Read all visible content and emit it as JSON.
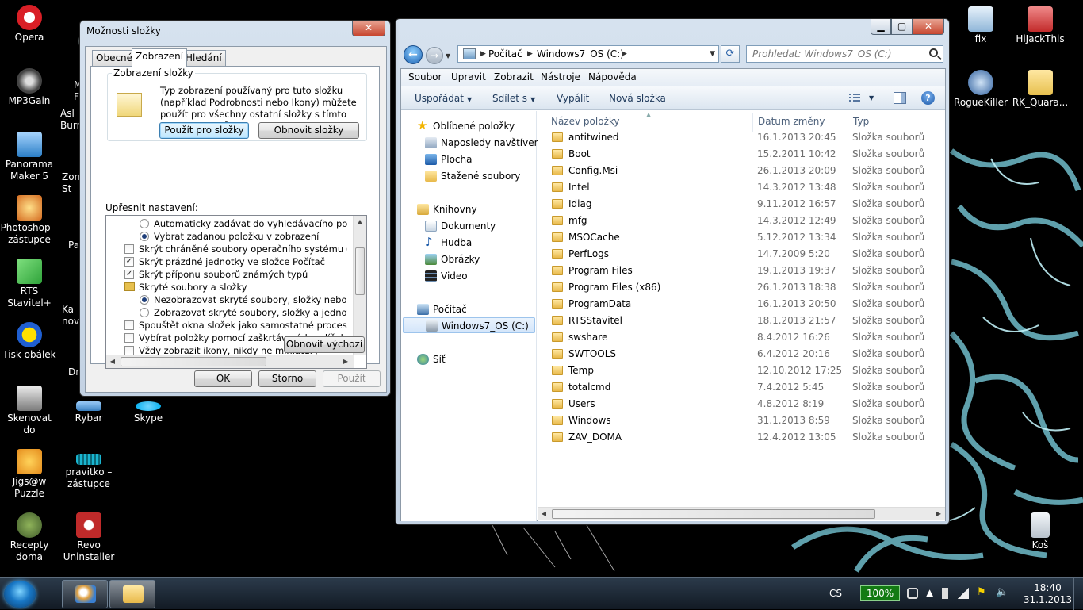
{
  "desktop": {
    "left_icons": [
      {
        "label": "Opera",
        "color": "#d91f26"
      },
      {
        "label": "MP3Gain",
        "color": "#555555"
      },
      {
        "label": "Panorama Maker 5",
        "color": "#2b7ec6"
      },
      {
        "label": "Photoshop – zástupce",
        "color": "#d46a1f"
      },
      {
        "label": "RTS Stavitel+",
        "color": "#2fa33a"
      },
      {
        "label": "Tisk obálek",
        "color": "#1f5fd1"
      },
      {
        "label": "Skenovat do",
        "color": "#7a7a7a"
      },
      {
        "label": "Jigs@w Puzzle",
        "color": "#e48a1b"
      },
      {
        "label": "Recepty doma",
        "color": "#3f5a2a"
      }
    ],
    "col2_partial_labels": [
      "M\nF",
      "Asl\nBurn",
      "Zon\nSt",
      "Pa",
      "Ka\nnov",
      "Dr"
    ],
    "col2_icons": [
      {
        "label": "Rybar",
        "color": "#3a7fbf"
      },
      {
        "label": "pravitko – zástupce",
        "color": "#1ab5d0"
      },
      {
        "label": "Revo Uninstaller",
        "color": "#c02a2a"
      }
    ],
    "col3_icons": [
      {
        "label": "Skype",
        "color": "#00aff0"
      }
    ],
    "right_icons": [
      {
        "label": "fix",
        "color": "#8fb6d8"
      },
      {
        "label": "HiJackThis",
        "color": "#c22a2a"
      },
      {
        "label": "RogueKiller",
        "color": "#2c5d9c"
      },
      {
        "label": "RK_Quara...",
        "color": "#e7c04e"
      },
      {
        "label": "Koš",
        "color": "#b8c2cc"
      }
    ]
  },
  "taskbar": {
    "language": "CS",
    "battery": "100%",
    "time": "18:40",
    "date": "31.1.2013"
  },
  "dialog": {
    "title": "Možnosti složky",
    "close_label": "✕",
    "tabs": [
      "Obecné",
      "Zobrazení",
      "Hledání"
    ],
    "active_tab": "Zobrazení",
    "group_title": "Zobrazení složky",
    "group_text": "Typ zobrazení používaný pro tuto složku (například Podrobnosti nebo Ikony) můžete použít pro všechny ostatní složky s tímto typem souborů.",
    "apply_to_folders": "Použít pro složky",
    "reset_folders": "Obnovit složky",
    "advanced_label": "Upřesnit nastavení:",
    "advanced_items": [
      {
        "kind": "radio",
        "checked": false,
        "indent": 2,
        "text": "Automaticky zadávat do vyhledávacího pole"
      },
      {
        "kind": "radio",
        "checked": true,
        "indent": 2,
        "text": "Vybrat zadanou položku v zobrazení"
      },
      {
        "kind": "check",
        "checked": false,
        "indent": 1,
        "text": "Skrýt chráněné soubory operačního systému (doporučeno)"
      },
      {
        "kind": "check",
        "checked": true,
        "indent": 1,
        "text": "Skrýt prázdné jednotky ve složce Počítač"
      },
      {
        "kind": "check",
        "checked": true,
        "indent": 1,
        "text": "Skrýt příponu souborů známých typů"
      },
      {
        "kind": "folder",
        "checked": false,
        "indent": 1,
        "text": "Skryté soubory a složky"
      },
      {
        "kind": "radio",
        "checked": true,
        "indent": 2,
        "text": "Nezobrazovat skryté soubory, složky nebo jednotky"
      },
      {
        "kind": "radio",
        "checked": false,
        "indent": 2,
        "text": "Zobrazovat skryté soubory, složky a jednotky"
      },
      {
        "kind": "check",
        "checked": false,
        "indent": 1,
        "text": "Spouštět okna složek jako samostatné procesy"
      },
      {
        "kind": "check",
        "checked": false,
        "indent": 1,
        "text": "Vybírat položky pomocí zaškrtávacích políček"
      },
      {
        "kind": "check",
        "checked": false,
        "indent": 1,
        "text": "Vždy zobrazit ikony, nikdy ne miniatury"
      }
    ],
    "restore_defaults": "Obnovit výchozí",
    "ok": "OK",
    "cancel": "Storno",
    "apply": "Použít"
  },
  "explorer": {
    "address": {
      "root": "Počítač",
      "drive": "Windows7_OS (C:)"
    },
    "search_placeholder": "Prohledat: Windows7_OS (C:)",
    "menu": [
      "Soubor",
      "Upravit",
      "Zobrazit",
      "Nástroje",
      "Nápověda"
    ],
    "commands": [
      "Uspořádat",
      "Sdílet s",
      "Vypálit",
      "Nová složka"
    ],
    "help": "?",
    "nav": {
      "favorites": "Oblíbené položky",
      "favorites_items": [
        "Naposledy navštívené",
        "Plocha",
        "Stažené soubory"
      ],
      "libraries": "Knihovny",
      "libraries_items": [
        "Dokumenty",
        "Hudba",
        "Obrázky",
        "Video"
      ],
      "computer": "Počítač",
      "computer_items": [
        "Windows7_OS (C:)"
      ],
      "network": "Síť"
    },
    "columns": [
      "Název položky",
      "Datum změny",
      "Typ"
    ],
    "files": [
      {
        "name": "antitwined",
        "date": "16.1.2013 20:45",
        "type": "Složka souborů"
      },
      {
        "name": "Boot",
        "date": "15.2.2011 10:42",
        "type": "Složka souborů"
      },
      {
        "name": "Config.Msi",
        "date": "26.1.2013 20:09",
        "type": "Složka souborů"
      },
      {
        "name": "Intel",
        "date": "14.3.2012 13:48",
        "type": "Složka souborů"
      },
      {
        "name": "Idiag",
        "date": "9.11.2012 16:57",
        "type": "Složka souborů"
      },
      {
        "name": "mfg",
        "date": "14.3.2012 12:49",
        "type": "Složka souborů"
      },
      {
        "name": "MSOCache",
        "date": "5.12.2012 13:34",
        "type": "Složka souborů"
      },
      {
        "name": "PerfLogs",
        "date": "14.7.2009 5:20",
        "type": "Složka souborů"
      },
      {
        "name": "Program Files",
        "date": "19.1.2013 19:37",
        "type": "Složka souborů"
      },
      {
        "name": "Program Files (x86)",
        "date": "26.1.2013 18:38",
        "type": "Složka souborů"
      },
      {
        "name": "ProgramData",
        "date": "16.1.2013 20:50",
        "type": "Složka souborů"
      },
      {
        "name": "RTSStavitel",
        "date": "18.1.2013 21:57",
        "type": "Složka souborů"
      },
      {
        "name": "swshare",
        "date": "8.4.2012 16:26",
        "type": "Složka souborů"
      },
      {
        "name": "SWTOOLS",
        "date": "6.4.2012 20:16",
        "type": "Složka souborů"
      },
      {
        "name": "Temp",
        "date": "12.10.2012 17:25",
        "type": "Složka souborů"
      },
      {
        "name": "totalcmd",
        "date": "7.4.2012 5:45",
        "type": "Složka souborů"
      },
      {
        "name": "Users",
        "date": "4.8.2012 8:19",
        "type": "Složka souborů"
      },
      {
        "name": "Windows",
        "date": "31.1.2013 8:59",
        "type": "Složka souborů"
      },
      {
        "name": "ZAV_DOMA",
        "date": "12.4.2012 13:05",
        "type": "Složka souborů"
      }
    ]
  }
}
